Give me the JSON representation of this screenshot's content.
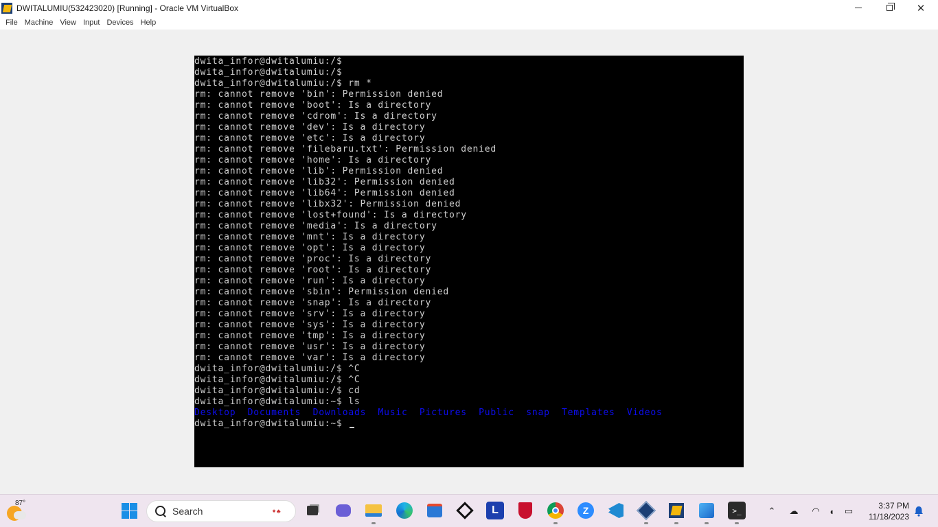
{
  "window": {
    "title": "DWITALUMIU(532423020) [Running] - Oracle VM VirtualBox",
    "minimize": "—",
    "close": "✕"
  },
  "menu": [
    "File",
    "Machine",
    "View",
    "Input",
    "Devices",
    "Help"
  ],
  "terminal": {
    "lines": [
      "dwita_infor@dwitalumiu:/$",
      "dwita_infor@dwitalumiu:/$",
      "dwita_infor@dwitalumiu:/$ rm *",
      "rm: cannot remove 'bin': Permission denied",
      "rm: cannot remove 'boot': Is a directory",
      "rm: cannot remove 'cdrom': Is a directory",
      "rm: cannot remove 'dev': Is a directory",
      "rm: cannot remove 'etc': Is a directory",
      "rm: cannot remove 'filebaru.txt': Permission denied",
      "rm: cannot remove 'home': Is a directory",
      "rm: cannot remove 'lib': Permission denied",
      "rm: cannot remove 'lib32': Permission denied",
      "rm: cannot remove 'lib64': Permission denied",
      "rm: cannot remove 'libx32': Permission denied",
      "rm: cannot remove 'lost+found': Is a directory",
      "rm: cannot remove 'media': Is a directory",
      "rm: cannot remove 'mnt': Is a directory",
      "rm: cannot remove 'opt': Is a directory",
      "rm: cannot remove 'proc': Is a directory",
      "rm: cannot remove 'root': Is a directory",
      "rm: cannot remove 'run': Is a directory",
      "rm: cannot remove 'sbin': Permission denied",
      "rm: cannot remove 'snap': Is a directory",
      "rm: cannot remove 'srv': Is a directory",
      "rm: cannot remove 'sys': Is a directory",
      "rm: cannot remove 'tmp': Is a directory",
      "rm: cannot remove 'usr': Is a directory",
      "rm: cannot remove 'var': Is a directory",
      "dwita_infor@dwitalumiu:/$ ^C",
      "dwita_infor@dwitalumiu:/$ ^C",
      "dwita_infor@dwitalumiu:/$ cd",
      "dwita_infor@dwitalumiu:~$ ls"
    ],
    "ls_output": [
      "Desktop",
      "Documents",
      "Downloads",
      "Music",
      "Pictures",
      "Public",
      "snap",
      "Templates",
      "Videos"
    ],
    "ls_color": "#0d0df0",
    "prompt": "dwita_infor@dwitalumiu:~$ "
  },
  "taskbar": {
    "weather_temp": "87°",
    "search_label": "Search",
    "apps": [
      "start-icon",
      "task-view-icon",
      "chat-icon",
      "file-explorer-icon",
      "edge-icon",
      "store-icon",
      "dropbox-icon",
      "l-app-icon",
      "mcafee-icon",
      "chrome-icon",
      "zoom-icon",
      "vscode-icon",
      "virtualbox-icon",
      "app-icon",
      "photos-icon",
      "terminal-icon"
    ],
    "clock_time": "3:37 PM",
    "clock_date": "11/18/2023"
  }
}
